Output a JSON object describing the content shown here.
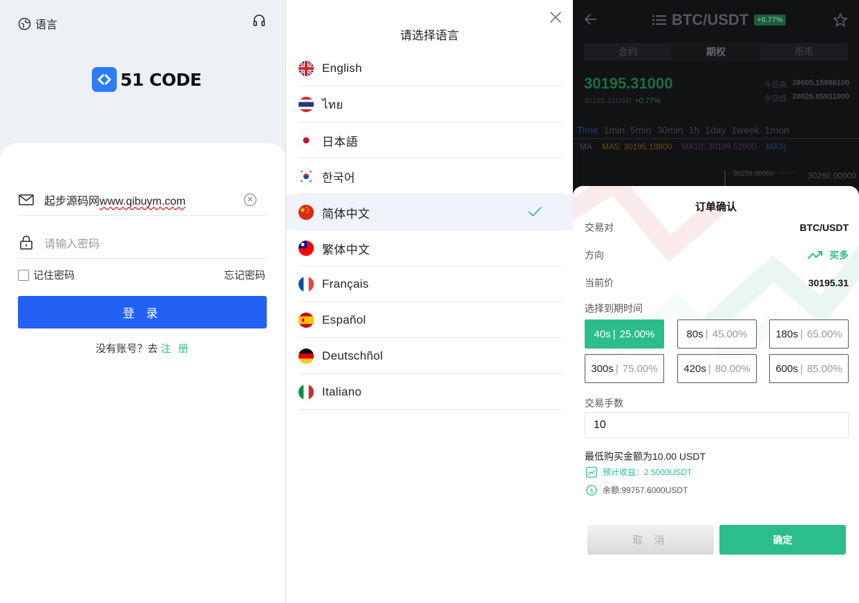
{
  "login": {
    "language_label": "语言",
    "brand": "51 CODE",
    "account_value_plain": "起步源码网",
    "account_value_link": "www.qibuym.com",
    "password_placeholder": "请输入密码",
    "remember_label": "记住密码",
    "forgot_label": "忘记密码",
    "login_button": "登 录",
    "no_account_text": "没有账号？去",
    "register_link": "注 册"
  },
  "language_picker": {
    "title": "请选择语言",
    "selected": "简体中文",
    "items": [
      {
        "label": "English",
        "flag": "uk-flag"
      },
      {
        "label": "ไทย",
        "flag": "thailand-flag"
      },
      {
        "label": "日本語",
        "flag": "japan-flag"
      },
      {
        "label": "한국어",
        "flag": "korea-flag"
      },
      {
        "label": "简体中文",
        "flag": "china-flag"
      },
      {
        "label": "繁体中文",
        "flag": "taiwan-flag"
      },
      {
        "label": "Français",
        "flag": "france-flag"
      },
      {
        "label": "Español",
        "flag": "spain-flag"
      },
      {
        "label": "Deutschñol",
        "flag": "germany-flag"
      },
      {
        "label": "Italiano",
        "flag": "italy-flag"
      }
    ]
  },
  "trade": {
    "pair": "BTC/USDT",
    "change_badge": "+0.77%",
    "tabs": [
      "合约",
      "期权",
      "币币"
    ],
    "active_tab": "期权",
    "last_price": "30195.31000",
    "price_usd": "30195.31USD",
    "price_change": "+0.77%",
    "high_label": "今日高",
    "high_value": "38605.15886100",
    "low_label": "今日低",
    "low_value": "20026.85931000",
    "intervals": [
      "Time",
      "1min",
      "5min",
      "30min",
      "1h",
      "1day",
      "1week",
      "1mon"
    ],
    "active_interval": "Time",
    "ma_label": "MA",
    "ma5": "MA5: 30195.19800",
    "ma10": "MA10: 30189.52900",
    "ma30": "MA3(",
    "chart_price_mid": "30258.00000",
    "chart_price_right": "30260.00000"
  },
  "order": {
    "title": "订单确认",
    "pair_label": "交易对",
    "pair_value": "BTC/USDT",
    "direction_label": "方向",
    "direction_value": "买多",
    "price_label": "当前价",
    "price_value": "30195.31",
    "expiry_label": "选择到期时间",
    "options": [
      {
        "time": "40s",
        "rate": "25.00%"
      },
      {
        "time": "80s",
        "rate": "45.00%"
      },
      {
        "time": "180s",
        "rate": "65.00%"
      },
      {
        "time": "300s",
        "rate": "75.00%"
      },
      {
        "time": "420s",
        "rate": "80.00%"
      },
      {
        "time": "600s",
        "rate": "85.00%"
      }
    ],
    "selected_option": "40s",
    "qty_label": "交易手数",
    "qty_value": "10",
    "min_amount": "最低购买金额为10.00 USDT",
    "expected_profit": "预计收益：2.5000USDT",
    "balance": "余额:99757.6000USDT",
    "cancel_button": "取 消",
    "confirm_button": "确定"
  },
  "colors": {
    "login_blue": "#2361f5",
    "accent_green": "#2bbd8a",
    "brand_blue": "#2f7cf6",
    "dark_bg": "#111214"
  }
}
